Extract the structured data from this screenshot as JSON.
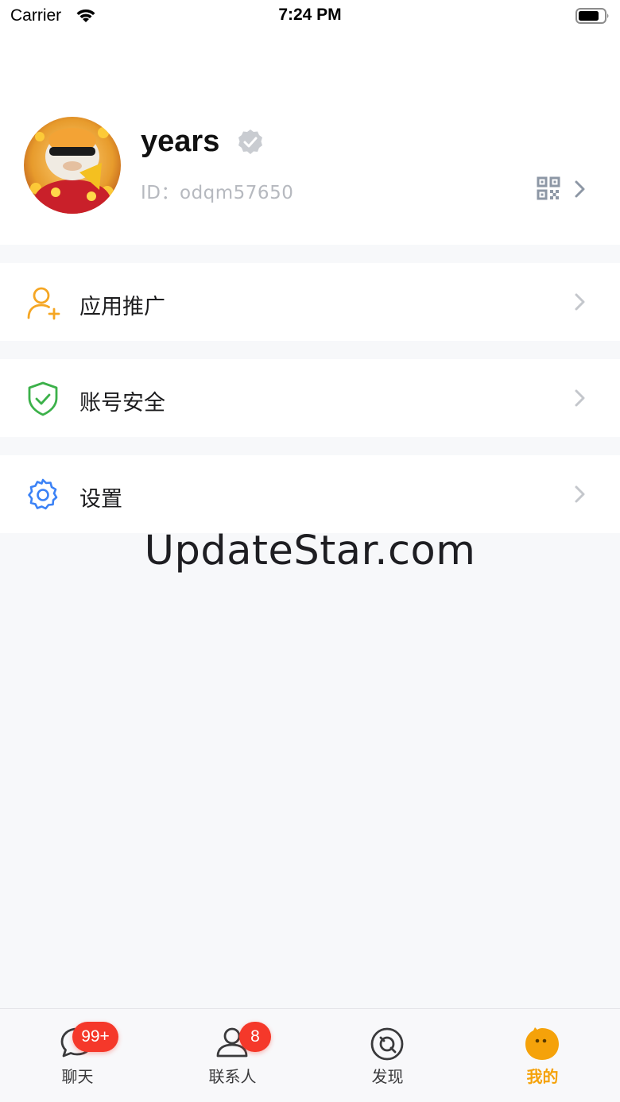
{
  "status_bar": {
    "carrier": "Carrier",
    "time": "7:24 PM",
    "wifi_icon": "wifi-icon",
    "battery_icon": "battery-icon"
  },
  "profile": {
    "name": "years",
    "id_text": "ID：odqm57650",
    "verified_icon": "verified-badge-icon",
    "qr_icon": "qr-code-icon"
  },
  "menu": {
    "items": [
      {
        "label": "应用推广",
        "icon": "user-plus-icon",
        "icon_color": "#f5a623"
      },
      {
        "label": "账号安全",
        "icon": "shield-check-icon",
        "icon_color": "#3cb14a"
      },
      {
        "label": "设置",
        "icon": "gear-icon",
        "icon_color": "#3b82f6"
      }
    ]
  },
  "watermark": "UpdateStar.com",
  "tab_bar": {
    "active_color": "#f5a20a",
    "badge_color": "#f5382a",
    "tabs": [
      {
        "label": "聊天",
        "icon": "chat-bubble-icon",
        "badge": "99+",
        "active": false
      },
      {
        "label": "联系人",
        "icon": "contact-person-icon",
        "badge": "8",
        "active": false
      },
      {
        "label": "发现",
        "icon": "discover-compass-icon",
        "active": false
      },
      {
        "label": "我的",
        "icon": "mine-face-icon",
        "active": true
      }
    ]
  }
}
